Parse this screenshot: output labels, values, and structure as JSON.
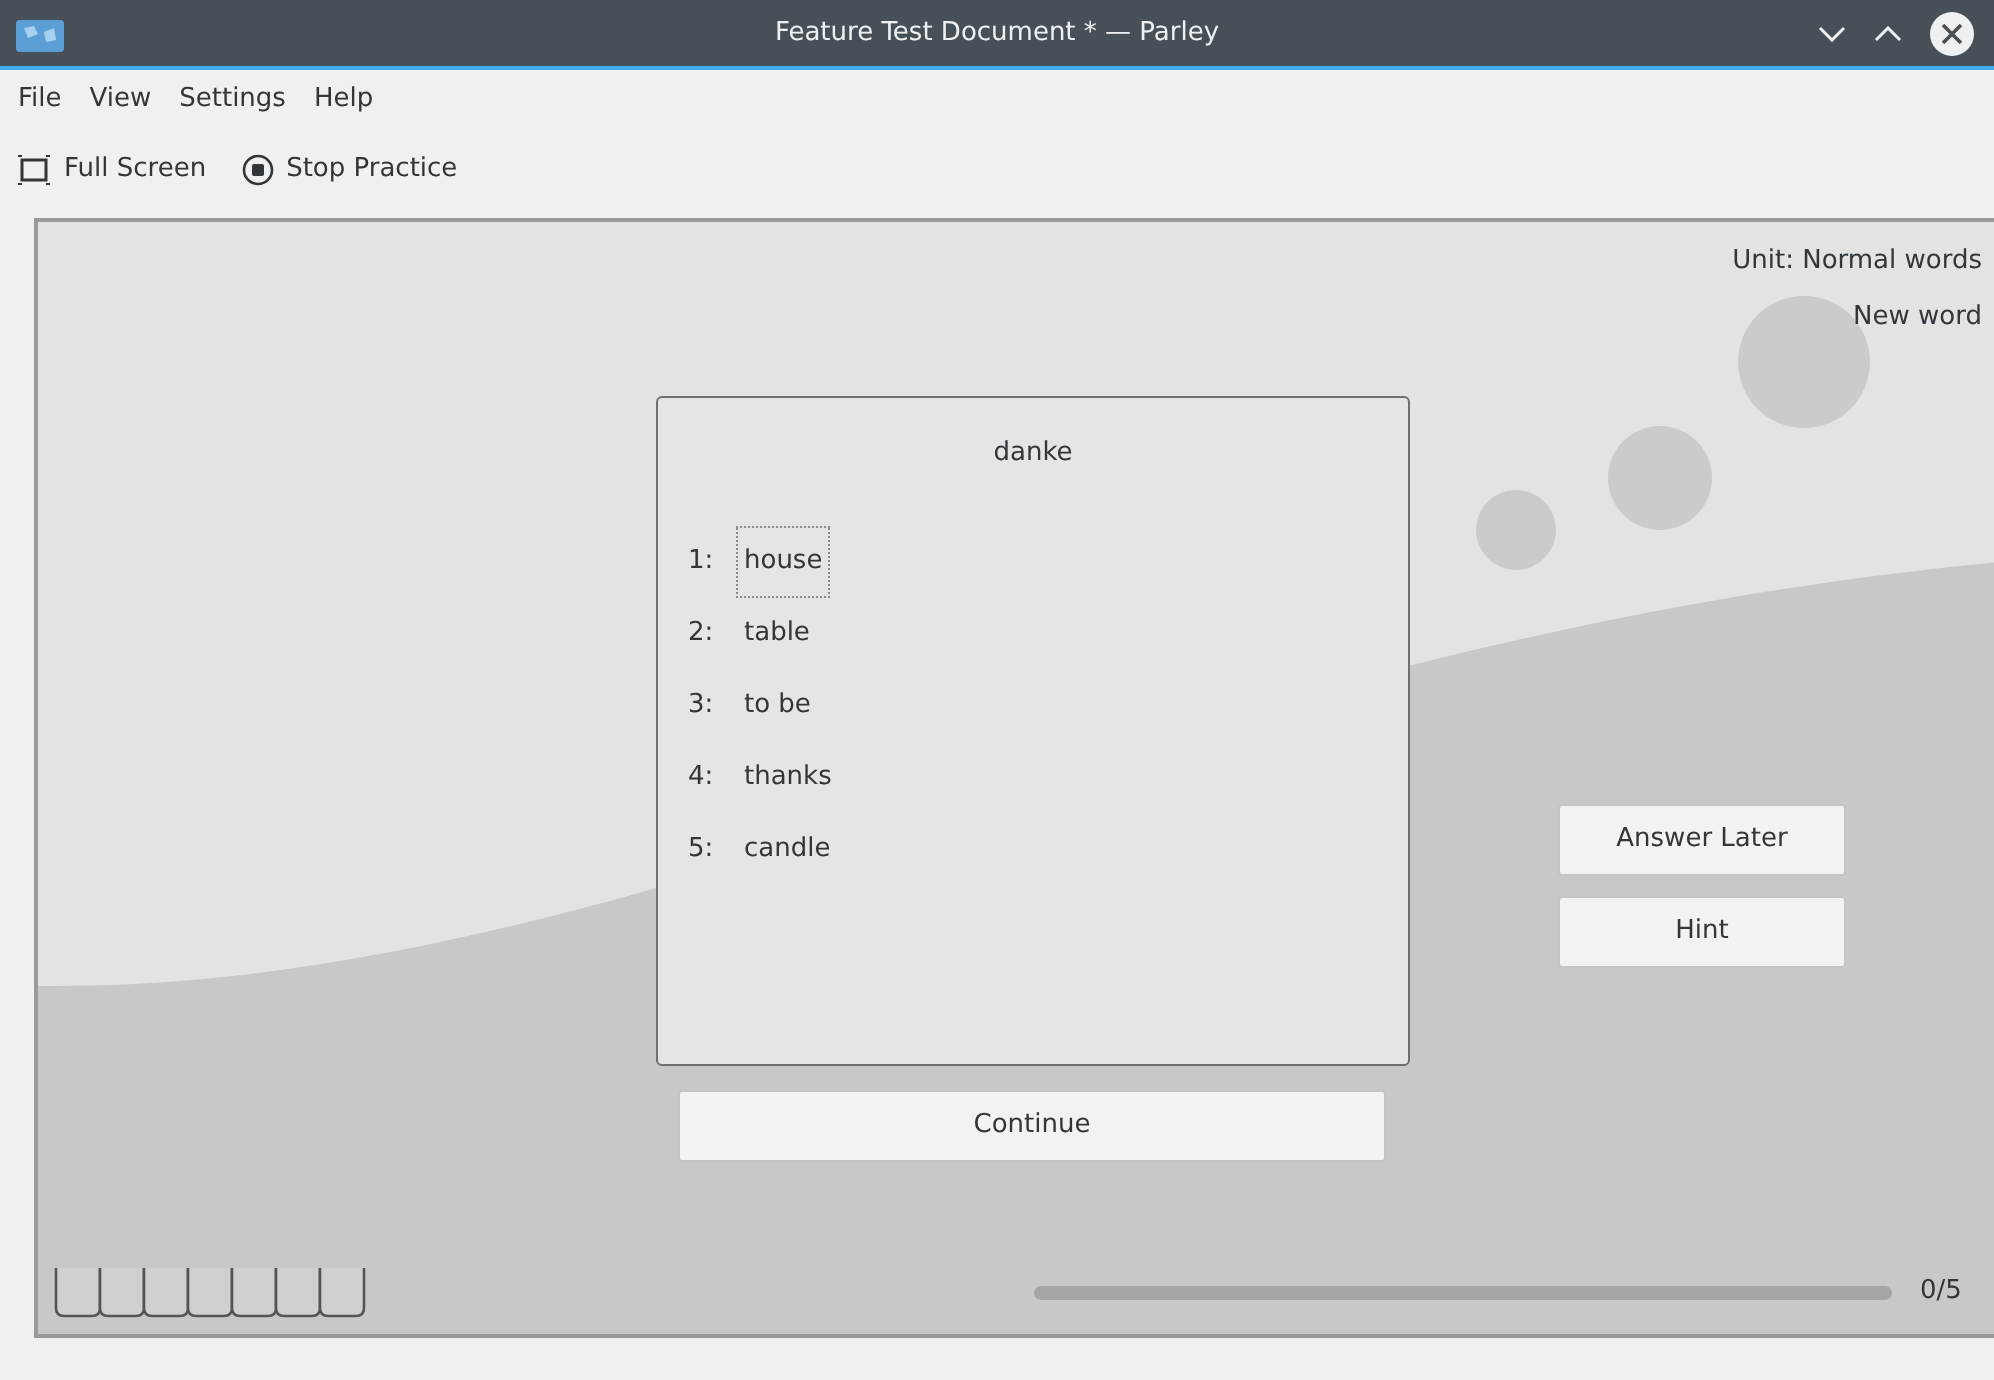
{
  "window": {
    "title": "Feature Test Document * — Parley"
  },
  "menu": [
    "File",
    "View",
    "Settings",
    "Help"
  ],
  "toolbar": [
    {
      "kind": "fullscreen",
      "label": "Full Screen"
    },
    {
      "kind": "stop",
      "label": "Stop Practice"
    }
  ],
  "practice": {
    "unit": "Unit: Normal words",
    "status": "New word",
    "question": "danke",
    "choices": [
      {
        "number": "1:",
        "text": "house",
        "selected": true
      },
      {
        "number": "2:",
        "text": "table",
        "selected": false
      },
      {
        "number": "3:",
        "text": "to be",
        "selected": false
      },
      {
        "number": "4:",
        "text": "thanks",
        "selected": false
      },
      {
        "number": "5:",
        "text": "candle",
        "selected": false
      }
    ],
    "continue_button": "Continue",
    "side_buttons": [
      "Answer Later",
      "Hint"
    ],
    "progress": {
      "level": 0,
      "reading": "0/5"
    }
  }
}
